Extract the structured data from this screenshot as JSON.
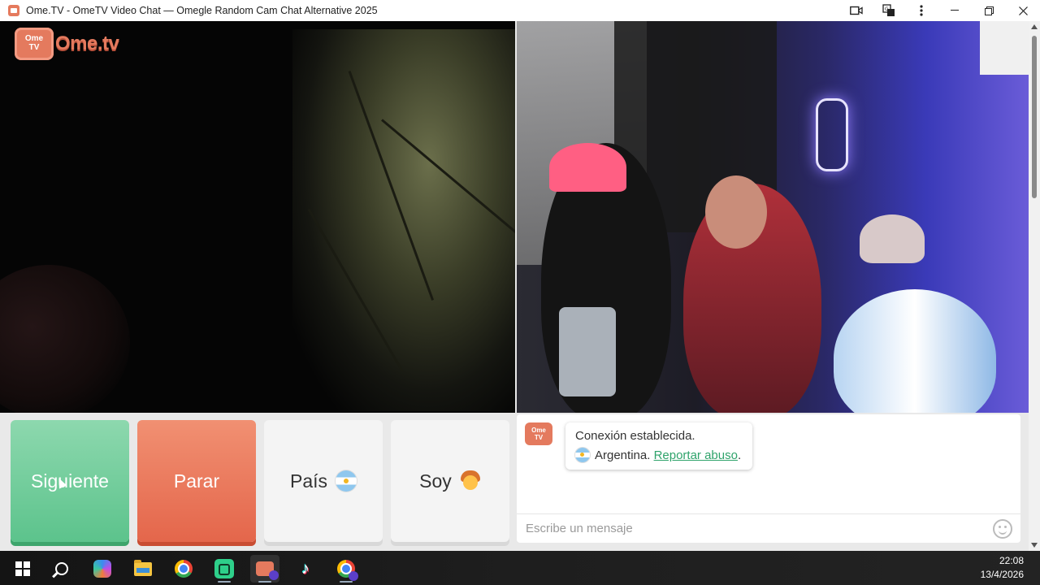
{
  "window": {
    "title": "Ome.TV - OmeTV Video Chat — Omegle Random Cam Chat Alternative 2025",
    "controls": [
      "camera-icon",
      "translate-icon",
      "more-icon",
      "minimize-icon",
      "restore-icon",
      "close-icon"
    ]
  },
  "logo": {
    "tv_text": "Ome\nTV",
    "word": "Ome.tv"
  },
  "buttons": {
    "next": "Siguiente",
    "stop": "Parar",
    "country": "País",
    "gender": "Soy"
  },
  "chat": {
    "logo_text": "Ome TV",
    "message_line1": "Conexión establecida.",
    "message_country": "Argentina.",
    "report_link": "Reportar abuso",
    "report_suffix": ".",
    "input_placeholder": "Escribe un mensaje"
  },
  "taskbar": {
    "apps": [
      "windows-start",
      "search",
      "copilot",
      "file-explorer",
      "chrome",
      "green-app",
      "ometv-app",
      "tiktok",
      "chrome-profile"
    ],
    "time": "22:08",
    "date": "13/4/2026"
  },
  "colors": {
    "next_green": "#5cc38c",
    "stop_red": "#e4664b",
    "brand": "#e47a5e",
    "link": "#2fa36b"
  }
}
